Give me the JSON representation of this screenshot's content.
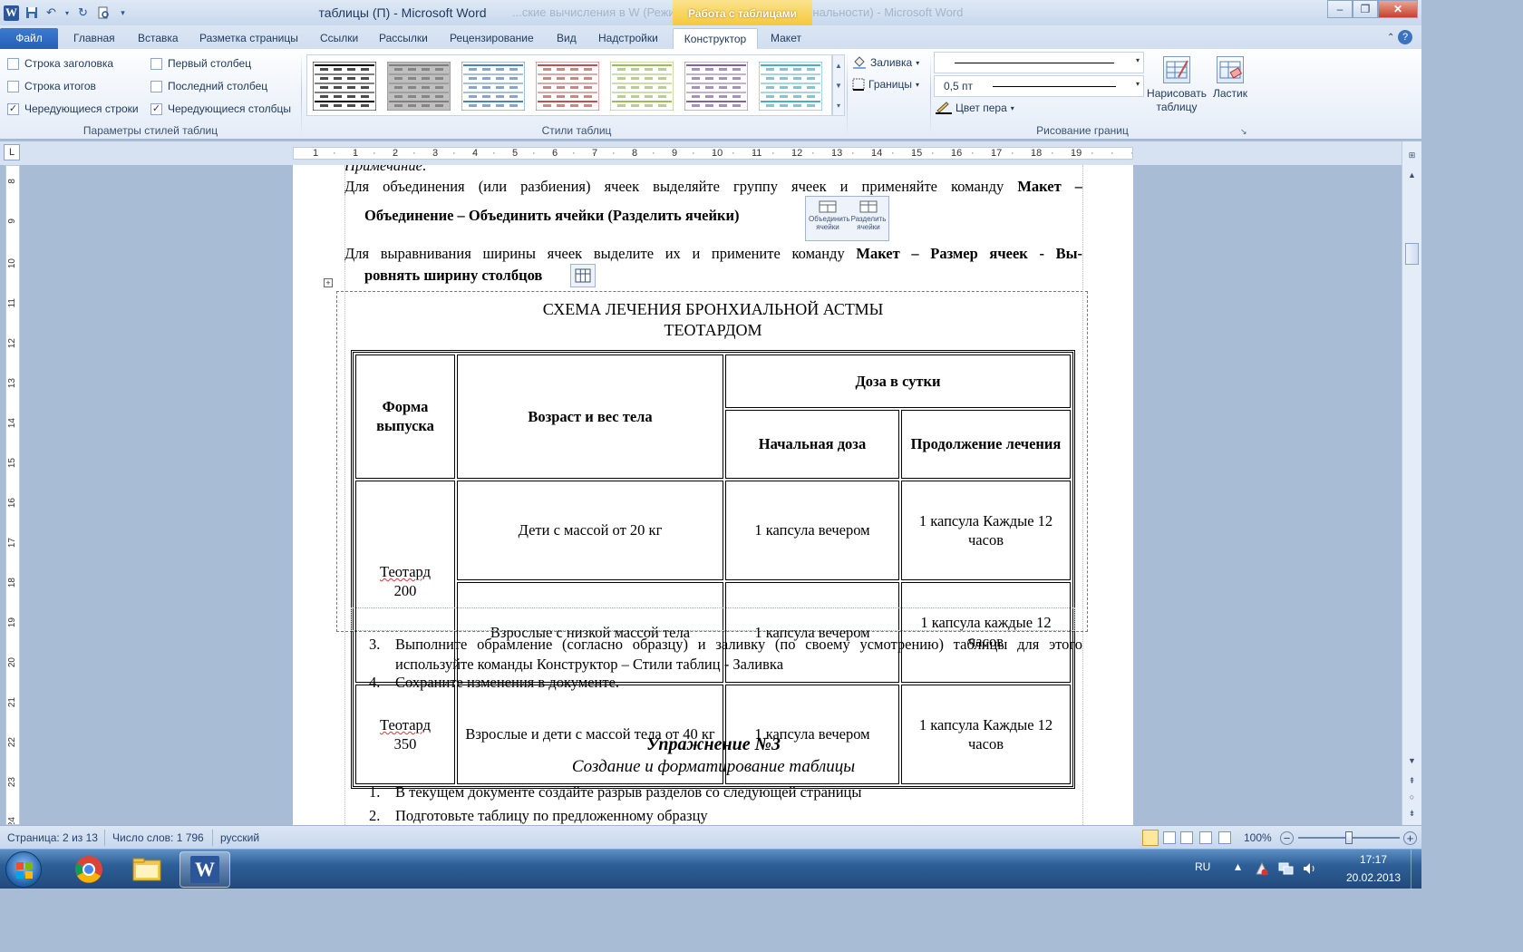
{
  "window": {
    "title": "таблицы (П) - Microsoft Word",
    "ghost_title": "...ские вычисления в W (Режим ограниченной функциональности) - Microsoft Word",
    "context_tab": "Работа с таблицами",
    "min": "–",
    "max": "❐",
    "close": "✕"
  },
  "tabs": {
    "file": "Файл",
    "home": "Главная",
    "insert": "Вставка",
    "layout_page": "Разметка страницы",
    "refs": "Ссылки",
    "mail": "Рассылки",
    "review": "Рецензирование",
    "view": "Вид",
    "addins": "Надстройки",
    "design": "Конструктор",
    "layout": "Макет"
  },
  "ribbon": {
    "opts": {
      "header_row": "Строка заголовка",
      "total_row": "Строка итогов",
      "banded_rows": "Чередующиеся строки",
      "first_col": "Первый столбец",
      "last_col": "Последний столбец",
      "banded_cols": "Чередующиеся столбцы",
      "group": "Параметры стилей таблиц"
    },
    "styles_group": "Стили таблиц",
    "shading": "Заливка",
    "borders": "Границы",
    "pen_weight": "0,5 пт",
    "pen_color": "Цвет пера",
    "draw_table": "Нарисовать таблицу",
    "eraser": "Ластик",
    "draw_group": "Рисование границ",
    "style_colors": [
      "#000000",
      "#7f7f7f",
      "#4f81bd",
      "#c0504d",
      "#9bbb59",
      "#8064a2",
      "#4bacc6"
    ]
  },
  "ruler": {
    "h_ticks": [
      "1",
      "1",
      "2",
      "3",
      "4",
      "5",
      "6",
      "7",
      "8",
      "9",
      "10",
      "11",
      "12",
      "13",
      "14",
      "15",
      "16",
      "17",
      "18",
      "19"
    ],
    "v_ticks": [
      "8",
      "9",
      "10",
      "11",
      "12",
      "13",
      "14",
      "15",
      "16",
      "17",
      "18",
      "19",
      "20",
      "21",
      "22",
      "23",
      "24"
    ]
  },
  "doc": {
    "note": "Примечание:",
    "p1_a": "Для объединения (или разбиения) ячеек выделяйте группу ячеек и применяйте команду",
    "p1_b": "Макет –",
    "p1_c": "Объединение – Объединить ячейки (Разделить ячейки)",
    "merge_icon": "Объединить ячейки",
    "split_icon": "Разделить ячейки",
    "p2_a": "Для выравнивания ширины ячеек выделите их и примените команду",
    "p2_b": "Макет – Размер ячеек - Вы-",
    "p2_c": "ровнять ширину столбцов",
    "table_title_1": "СХЕМА ЛЕЧЕНИЯ БРОНХИАЛЬНОЙ АСТМЫ",
    "table_title_2": "ТЕОТАРДОМ",
    "table": {
      "h_form": "Форма выпуска",
      "h_age": "Возраст и вес тела",
      "h_dose": "Доза в сутки",
      "h_start": "Начальная доза",
      "h_cont": "Продолжение лечения",
      "r1_form_a": "Теотард",
      "r1_form_b": "200",
      "r1_age": "Дети с массой от 20 кг",
      "r1_start": "1 капсула вечером",
      "r1_cont": "1 капсула Каждые 12 часов",
      "r2_age": "Взрослые с низкой массой тела",
      "r2_start": "1 капсула вечером",
      "r2_cont": "1 капсула каждые 12 часов",
      "r3_form_a": "Теотард",
      "r3_form_b": "350",
      "r3_age": "Взрослые и дети с массой тела от 40 кг",
      "r3_start": "1 капсула вечером",
      "r3_cont": "1 капсула Каждые 12 часов"
    },
    "li3_num": "3.",
    "li3": "Выполните обрамление (согласно образцу) и заливку (по своему усмотрению) таблицы для этого используйте команды Конструктор – Стили таблиц - Заливка",
    "li4_num": "4.",
    "li4": "Сохраните изменения в документе.",
    "ex_title": "Упражнение №3",
    "ex_sub": "Создание и форматирование  таблицы",
    "e1_num": "1.",
    "e1": "В текущем документе создайте разрыв разделов со следующей страницы",
    "e2_num": "2.",
    "e2": "Подготовьте таблицу по предложенному образцу"
  },
  "status": {
    "page": "Страница: 2 из 13",
    "words": "Число слов: 1 796",
    "lang": "русский",
    "zoom": "100%",
    "zoom_level": 1.0
  },
  "taskbar": {
    "lang": "RU",
    "time": "17:17",
    "date": "20.02.2013"
  }
}
